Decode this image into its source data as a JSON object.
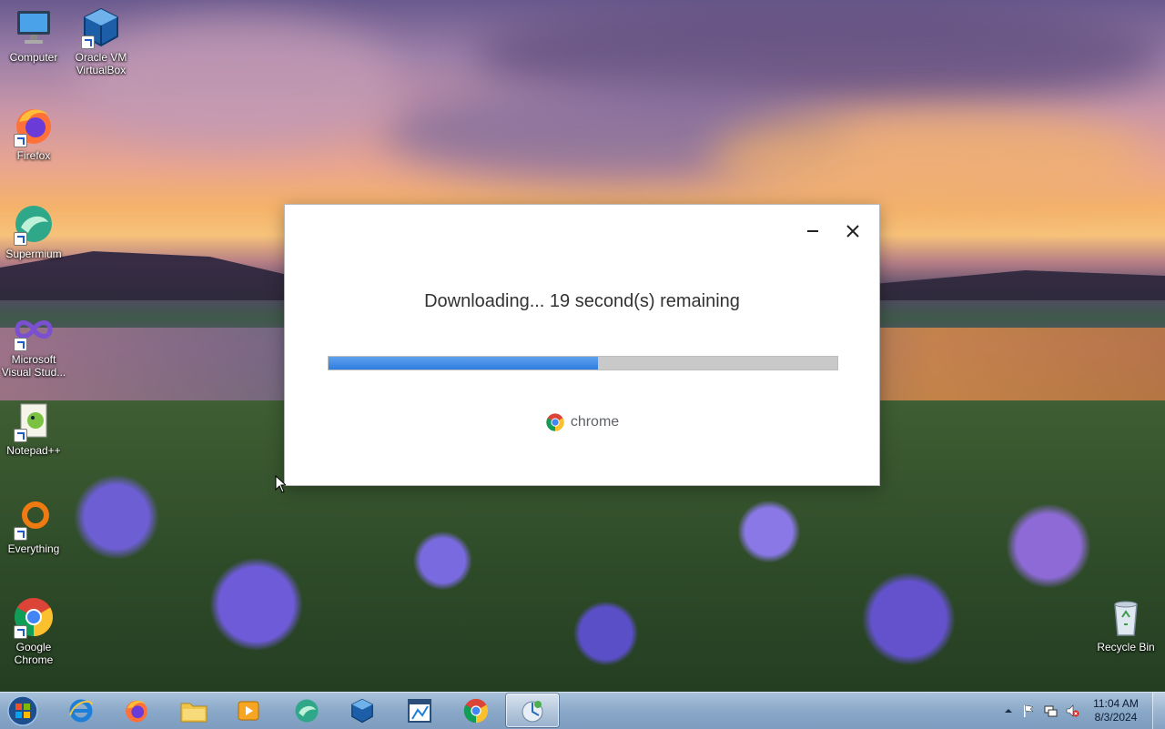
{
  "desktop_icons": [
    {
      "name": "computer",
      "label": "Computer",
      "icon": "computer-icon"
    },
    {
      "name": "virtualbox",
      "label": "Oracle VM VirtualBox",
      "icon": "virtualbox-icon"
    },
    {
      "name": "firefox",
      "label": "Firefox",
      "icon": "firefox-icon"
    },
    {
      "name": "supermium",
      "label": "Supermium",
      "icon": "supermium-icon"
    },
    {
      "name": "visual-studio",
      "label": "Microsoft Visual Stud...",
      "icon": "visual-studio-icon"
    },
    {
      "name": "notepad-plus-plus",
      "label": "Notepad++",
      "icon": "notepad-plus-plus-icon"
    },
    {
      "name": "everything",
      "label": "Everything",
      "icon": "everything-icon"
    },
    {
      "name": "google-chrome",
      "label": "Google Chrome",
      "icon": "chrome-icon"
    },
    {
      "name": "recycle-bin",
      "label": "Recycle Bin",
      "icon": "recycle-bin-icon"
    }
  ],
  "dialog": {
    "status": "Downloading... 19 second(s) remaining",
    "progress_fraction": 0.53,
    "brand_label": "chrome",
    "minimize_icon": "minimize-icon",
    "close_icon": "close-icon",
    "progress_color": "#3a84e6"
  },
  "taskbar": {
    "items": [
      {
        "name": "internet-explorer",
        "icon": "internet-explorer-icon",
        "active": false
      },
      {
        "name": "firefox",
        "icon": "firefox-icon",
        "active": false
      },
      {
        "name": "file-explorer",
        "icon": "folder-icon",
        "active": false
      },
      {
        "name": "media-player",
        "icon": "media-player-icon",
        "active": false
      },
      {
        "name": "supermium",
        "icon": "supermium-icon",
        "active": false
      },
      {
        "name": "virtualbox",
        "icon": "virtualbox-icon",
        "active": false
      },
      {
        "name": "task-window",
        "icon": "window-app-icon",
        "active": false
      },
      {
        "name": "chrome",
        "icon": "chrome-icon",
        "active": false
      },
      {
        "name": "chrome-installer",
        "icon": "installer-icon",
        "active": true
      }
    ],
    "clock_time": "11:04 AM",
    "clock_date": "8/3/2024",
    "tray_icons": [
      "show-hidden-icons-icon",
      "action-center-flag-icon",
      "network-icon",
      "volume-muted-icon"
    ]
  }
}
